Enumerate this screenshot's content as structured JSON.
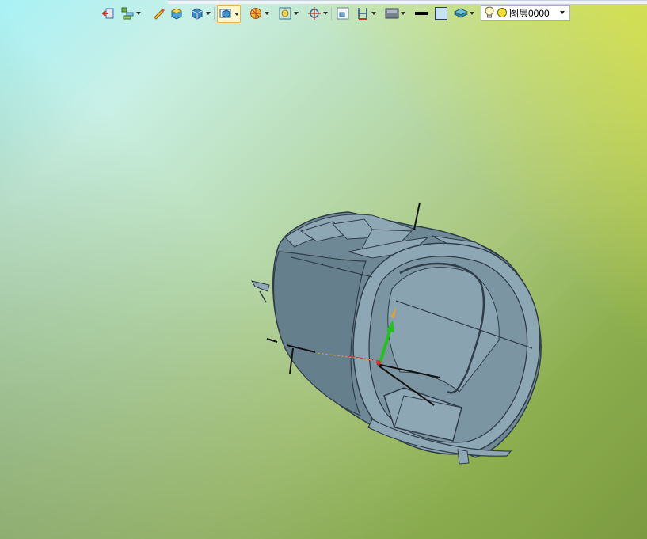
{
  "toolbar": {
    "buttons": [
      {
        "name": "exit-sketch",
        "icon": "exit-arrow-icon",
        "dropdown": false
      },
      {
        "name": "assembly",
        "icon": "assembly-stack-icon",
        "dropdown": true
      },
      {
        "name": "pencil",
        "icon": "pencil-icon",
        "dropdown": false
      },
      {
        "name": "shaded-box",
        "icon": "shaded-box-icon",
        "dropdown": false
      },
      {
        "name": "view-cube",
        "icon": "view-cube-icon",
        "dropdown": true
      },
      {
        "name": "display-mode",
        "icon": "display-mode-icon",
        "dropdown": true,
        "active": true
      },
      {
        "name": "render-style",
        "icon": "render-style-icon",
        "dropdown": true
      },
      {
        "name": "zoom-fit",
        "icon": "zoom-fit-icon",
        "dropdown": true
      },
      {
        "name": "pan-target",
        "icon": "target-crosshair-icon",
        "dropdown": true
      },
      {
        "name": "window-select",
        "icon": "window-select-icon",
        "dropdown": false
      },
      {
        "name": "measure",
        "icon": "measure-icon",
        "dropdown": true
      },
      {
        "name": "background",
        "icon": "background-icon",
        "dropdown": true
      },
      {
        "name": "line-color",
        "icon": "line-color-icon",
        "dropdown": false
      },
      {
        "name": "face-color",
        "icon": "face-color-icon",
        "dropdown": false
      },
      {
        "name": "layers",
        "icon": "layers-icon",
        "dropdown": true
      }
    ],
    "layer": {
      "value": "图层0000",
      "visibility_icon": "light-bulb-icon",
      "status_icon": "yellow-circle-icon"
    }
  },
  "colors": {
    "model_body": "#6f8896",
    "model_light": "#8ea7b4",
    "model_edge": "#2f3e48",
    "axis_green": "#23c21f",
    "axis_red": "#d8322c",
    "axis_orange": "#f0a020"
  }
}
